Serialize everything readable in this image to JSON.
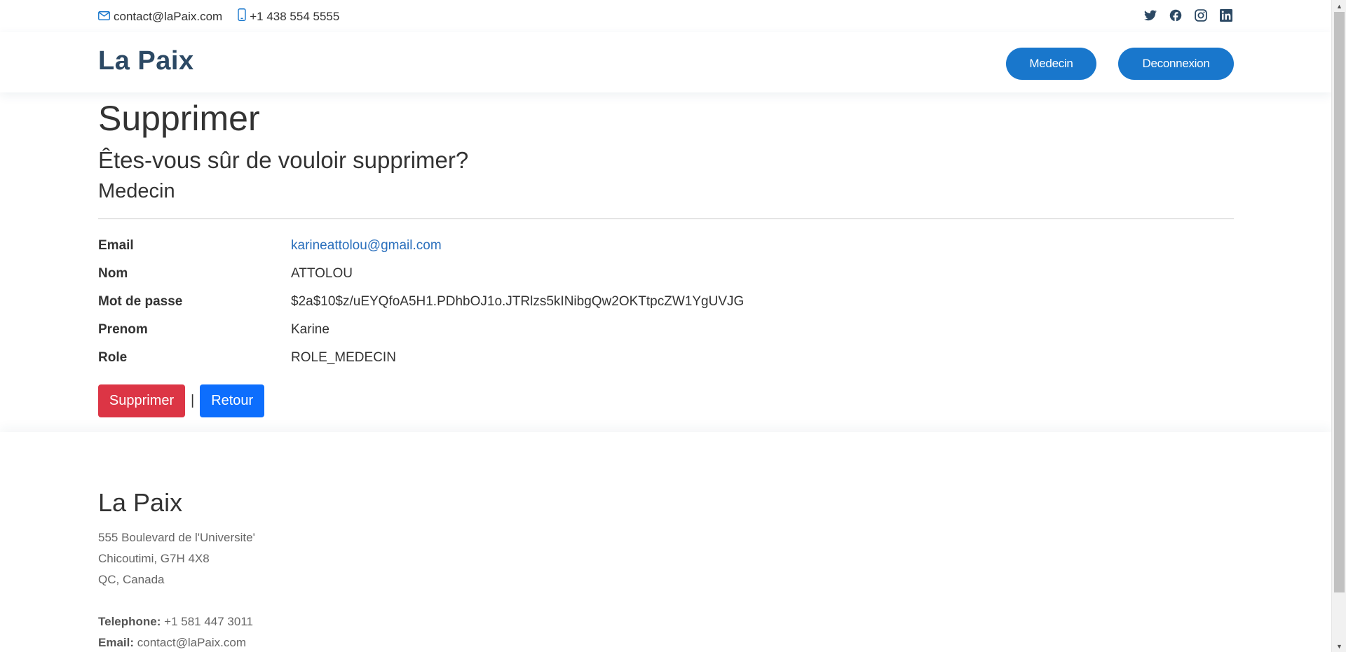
{
  "topbar": {
    "email": "contact@laPaix.com",
    "phone": "+1 438 554 5555",
    "social": [
      "twitter-icon",
      "facebook-icon",
      "instagram-icon",
      "linkedin-icon"
    ]
  },
  "header": {
    "logo": "La Paix",
    "nav": {
      "medecin": "Medecin",
      "logout": "Deconnexion"
    }
  },
  "main": {
    "title": "Supprimer",
    "question": "Êtes-vous sûr de vouloir supprimer?",
    "entity": "Medecin",
    "fields": [
      {
        "label": "Email",
        "value": "karineattolou@gmail.com"
      },
      {
        "label": "Nom",
        "value": "ATTOLOU"
      },
      {
        "label": "Mot de passe",
        "value": "$2a$10$z/uEYQfoA5H1.PDhbOJ1o.JTRlzs5kINibgQw2OKTtpcZW1YgUVJG"
      },
      {
        "label": "Prenom",
        "value": "Karine"
      },
      {
        "label": "Role",
        "value": "ROLE_MEDECIN"
      }
    ],
    "actions": {
      "delete": "Supprimer",
      "separator": "|",
      "back": "Retour"
    }
  },
  "footer": {
    "brand": "La Paix",
    "address1": "555 Boulevard de l'Universite'",
    "address2": "Chicoutimi, G7H 4X8",
    "address3": "QC, Canada",
    "telephone_label": "Telephone:",
    "telephone": "+1 581 447 3011",
    "email_label": "Email:",
    "email": "contact@laPaix.com"
  },
  "colors": {
    "brand": "#2c4964",
    "primary_nav": "#1977cc",
    "danger": "#dc3545",
    "primary": "#0d6efd",
    "link": "#2a6fbc"
  }
}
